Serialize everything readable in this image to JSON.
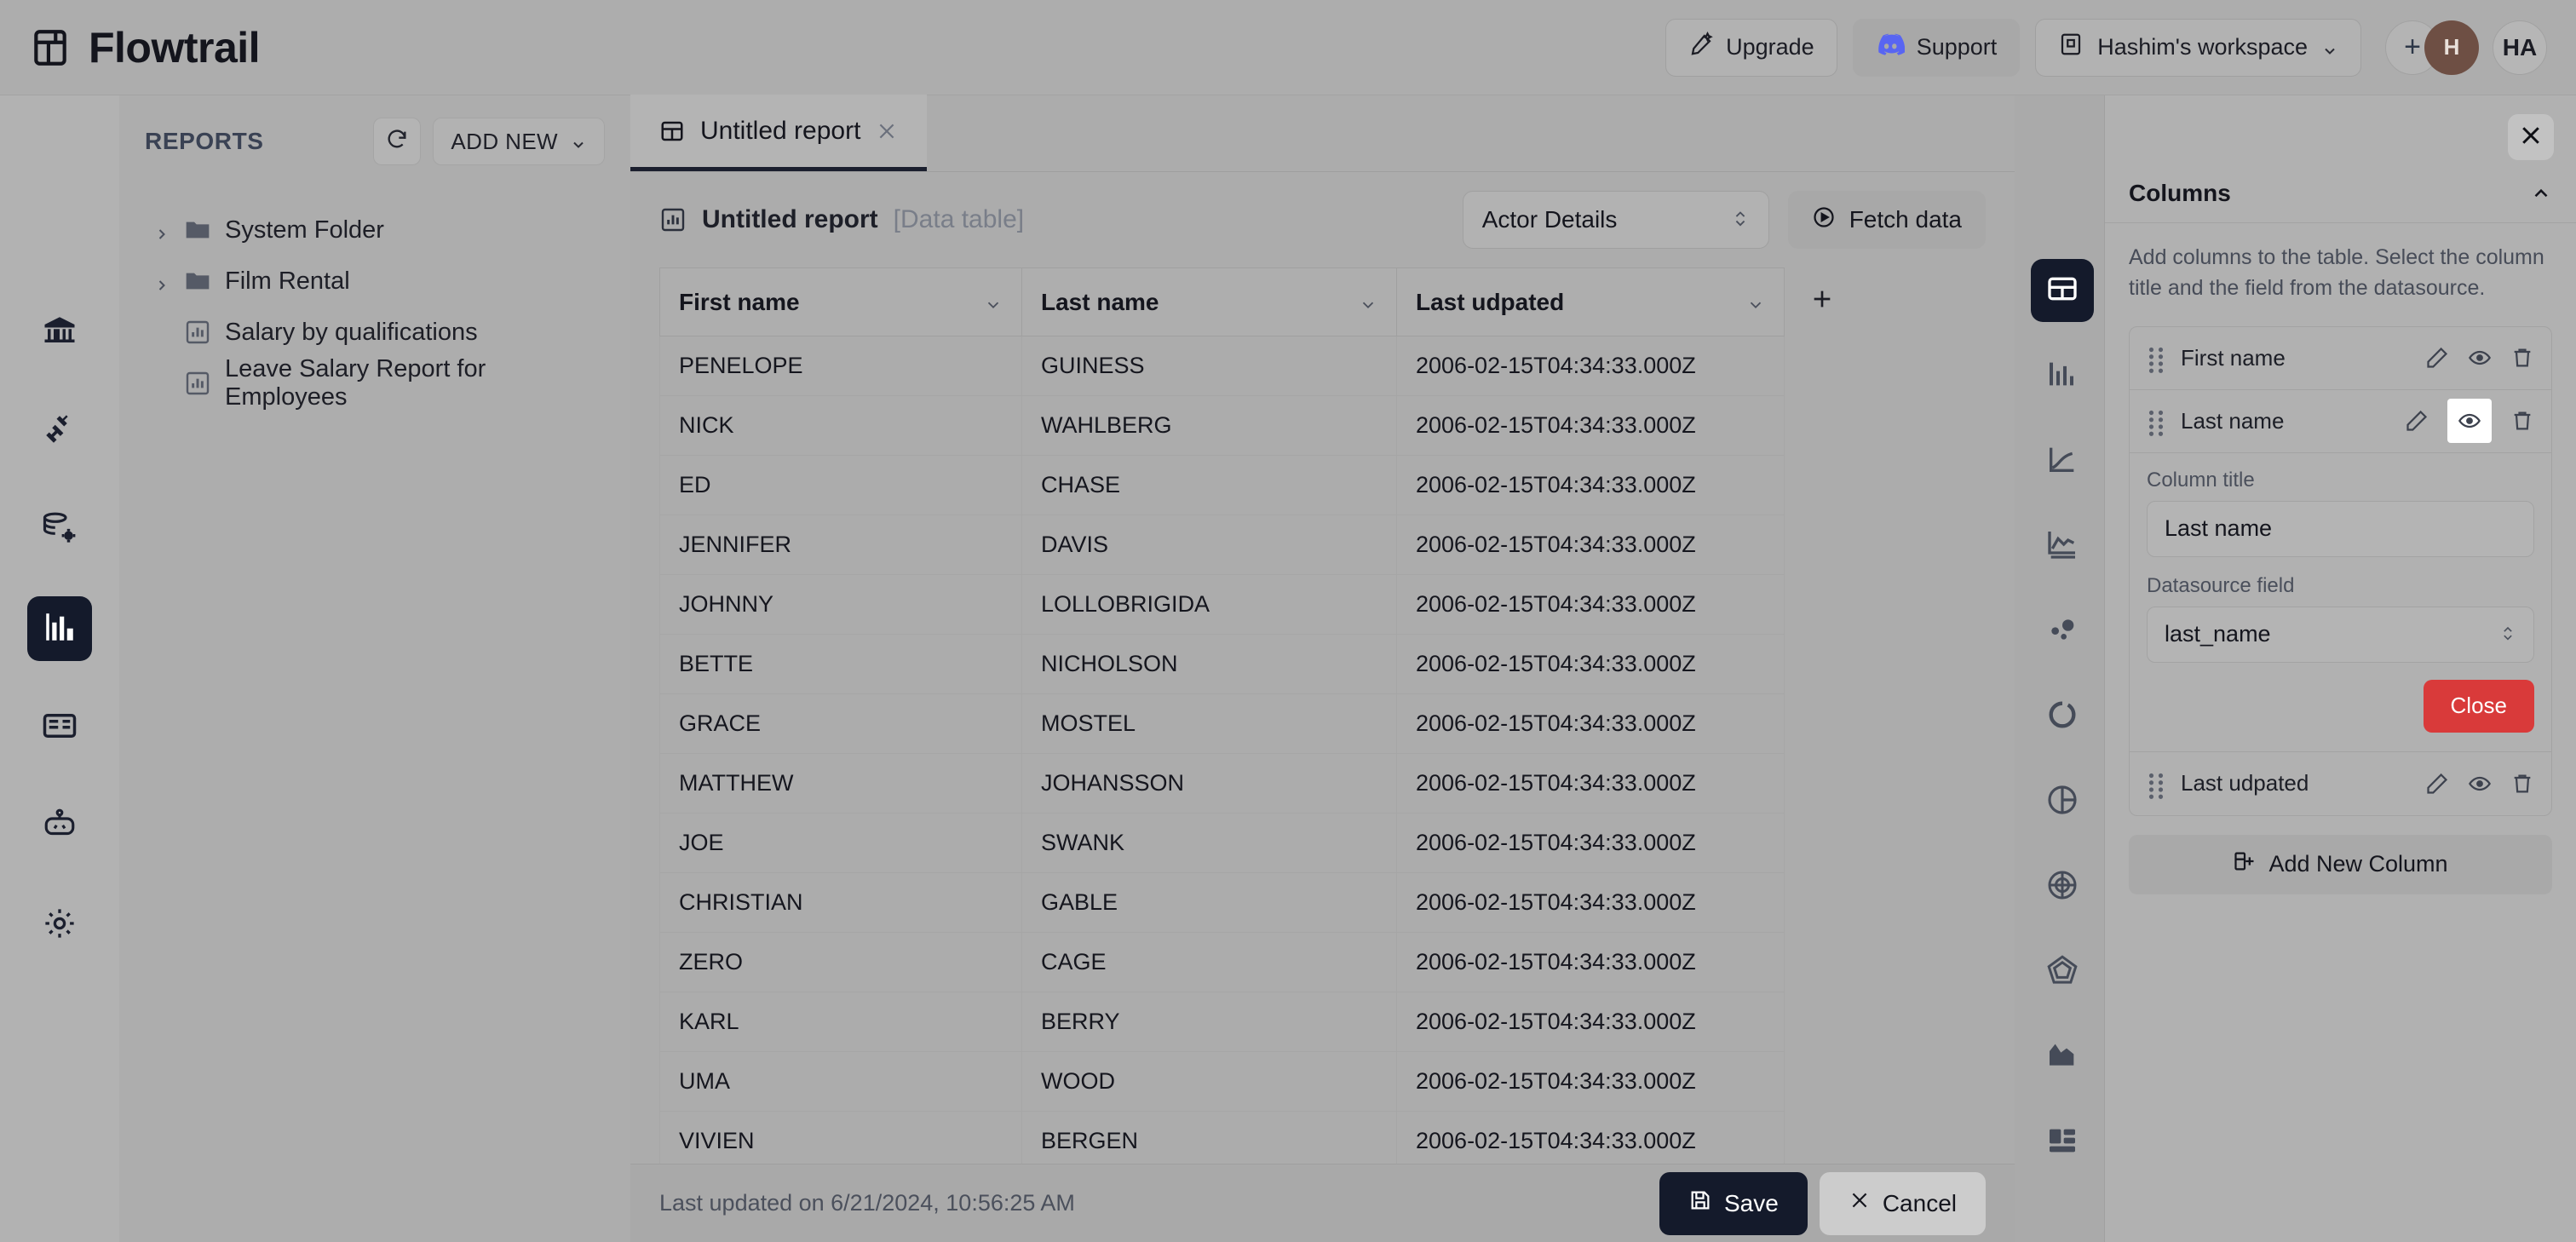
{
  "app": {
    "brand_name": "Flowtrail"
  },
  "header": {
    "upgrade_label": "Upgrade",
    "support_label": "Support",
    "workspace_label": "Hashim's workspace",
    "add_member_label": "+",
    "avatar_member": "H",
    "avatar_user": "HA"
  },
  "rail": {
    "items": [
      {
        "name": "home",
        "label": "Home"
      },
      {
        "name": "connections",
        "label": "Connections"
      },
      {
        "name": "datasources",
        "label": "Datasources"
      },
      {
        "name": "reports",
        "label": "Reports"
      },
      {
        "name": "dashboards",
        "label": "Dashboards"
      },
      {
        "name": "ai-assistant",
        "label": "AI Assistant"
      },
      {
        "name": "settings",
        "label": "Settings"
      }
    ]
  },
  "reports_panel": {
    "title": "REPORTS",
    "refresh_label": "Refresh",
    "add_new_label": "ADD NEW",
    "items": [
      {
        "label": "System Folder",
        "type": "folder"
      },
      {
        "label": "Film Rental",
        "type": "folder"
      },
      {
        "label": "Salary by qualifications",
        "type": "report"
      },
      {
        "label": "Leave Salary Report for Employees",
        "type": "report"
      }
    ]
  },
  "workspace": {
    "tab_label": "Untitled report",
    "report_title": "Untitled report",
    "report_subtitle": "[Data table]",
    "datasource_select": "Actor Details",
    "fetch_label": "Fetch data"
  },
  "table": {
    "columns": [
      "First name",
      "Last name",
      "Last udpated"
    ],
    "add_column_label": "+",
    "rows": [
      [
        "PENELOPE",
        "GUINESS",
        "2006-02-15T04:34:33.000Z"
      ],
      [
        "NICK",
        "WAHLBERG",
        "2006-02-15T04:34:33.000Z"
      ],
      [
        "ED",
        "CHASE",
        "2006-02-15T04:34:33.000Z"
      ],
      [
        "JENNIFER",
        "DAVIS",
        "2006-02-15T04:34:33.000Z"
      ],
      [
        "JOHNNY",
        "LOLLOBRIGIDA",
        "2006-02-15T04:34:33.000Z"
      ],
      [
        "BETTE",
        "NICHOLSON",
        "2006-02-15T04:34:33.000Z"
      ],
      [
        "GRACE",
        "MOSTEL",
        "2006-02-15T04:34:33.000Z"
      ],
      [
        "MATTHEW",
        "JOHANSSON",
        "2006-02-15T04:34:33.000Z"
      ],
      [
        "JOE",
        "SWANK",
        "2006-02-15T04:34:33.000Z"
      ],
      [
        "CHRISTIAN",
        "GABLE",
        "2006-02-15T04:34:33.000Z"
      ],
      [
        "ZERO",
        "CAGE",
        "2006-02-15T04:34:33.000Z"
      ],
      [
        "KARL",
        "BERRY",
        "2006-02-15T04:34:33.000Z"
      ],
      [
        "UMA",
        "WOOD",
        "2006-02-15T04:34:33.000Z"
      ],
      [
        "VIVIEN",
        "BERGEN",
        "2006-02-15T04:34:33.000Z"
      ]
    ]
  },
  "type_rail": {
    "items": [
      {
        "name": "table",
        "active": true
      },
      {
        "name": "bar-chart",
        "active": false
      },
      {
        "name": "line-chart",
        "active": false
      },
      {
        "name": "stepped-line-chart",
        "active": false
      },
      {
        "name": "scatter-chart",
        "active": false
      },
      {
        "name": "donut-chart",
        "active": false
      },
      {
        "name": "pie-chart",
        "active": false
      },
      {
        "name": "radar-chart",
        "active": false
      },
      {
        "name": "polar-chart",
        "active": false
      },
      {
        "name": "area-chart",
        "active": false
      },
      {
        "name": "kpi-cards",
        "active": false
      }
    ]
  },
  "columns_panel": {
    "close_label": "Close panel",
    "header_title": "Columns",
    "description": "Add columns to the table. Select the column title and the field from the datasource.",
    "columns": [
      {
        "label": "First name"
      },
      {
        "label": "Last name"
      },
      {
        "label": "Last udpated"
      }
    ],
    "editor": {
      "column_title_label": "Column title",
      "column_title_value": "Last name",
      "datasource_field_label": "Datasource field",
      "datasource_field_value": "last_name",
      "close_button_label": "Close",
      "close_button_color": "#d93a3a"
    },
    "add_new_column_label": "Add New Column"
  },
  "bottom_bar": {
    "status": "Last updated on 6/21/2024, 10:56:25 AM",
    "save_label": "Save",
    "cancel_label": "Cancel"
  }
}
